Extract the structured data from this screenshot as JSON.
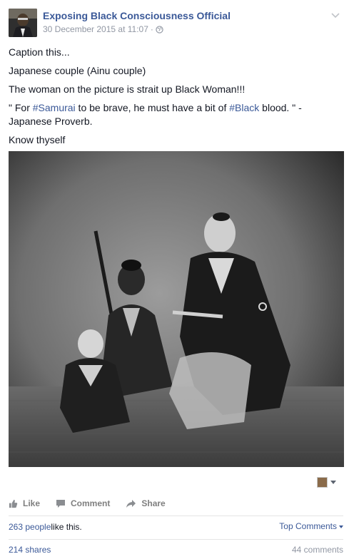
{
  "post": {
    "page_name": "Exposing Black Consciousness Official",
    "timestamp": "30 December 2015 at 11:07",
    "meta_separator": "·",
    "privacy_icon": "globe-icon",
    "menu_icon": "chevron-down-icon",
    "lines": {
      "l1": "Caption this...",
      "l2": "Japanese couple (Ainu couple)",
      "l3": "The woman on the picture is strait up Black Woman!!!",
      "l4_part1": "\" For ",
      "l4_tag1": "#Samurai",
      "l4_part2": " to be brave, he must have a bit of ",
      "l4_tag2": "#Black",
      "l4_part3": " blood. \" - Japanese Proverb.",
      "l5": "Know thyself"
    },
    "photo_icon": "photo-image"
  },
  "actions": {
    "like_label": "Like",
    "comment_label": "Comment",
    "share_label": "Share"
  },
  "stats": {
    "likes_link": "263 people",
    "likes_suffix": " like this.",
    "top_comments_label": "Top Comments",
    "shares_label": "214 shares",
    "comments_label": "44 comments"
  },
  "colors": {
    "link": "#3b5998",
    "text": "#141823",
    "meta": "#9197a3",
    "action": "#7f7f7f"
  }
}
